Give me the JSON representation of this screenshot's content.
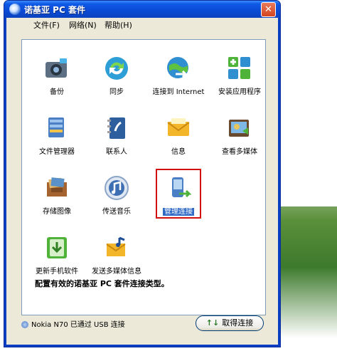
{
  "window": {
    "title": "诺基亚 PC 套件",
    "close_glyph": "✕"
  },
  "menu": [
    {
      "label": "文件(F)"
    },
    {
      "label": "网络(N)"
    },
    {
      "label": "帮助(H)"
    }
  ],
  "items": [
    {
      "label": "备份",
      "icon": "backup-camera-icon"
    },
    {
      "label": "同步",
      "icon": "sync-icon"
    },
    {
      "label": "连接到 Internet",
      "icon": "internet-connect-icon"
    },
    {
      "label": "安装应用程序",
      "icon": "install-apps-icon"
    },
    {
      "label": "文件管理器",
      "icon": "file-manager-icon"
    },
    {
      "label": "联系人",
      "icon": "contacts-icon"
    },
    {
      "label": "信息",
      "icon": "message-envelope-icon"
    },
    {
      "label": "查看多媒体",
      "icon": "multimedia-viewer-icon"
    },
    {
      "label": "存储图像",
      "icon": "store-images-icon"
    },
    {
      "label": "传送音乐",
      "icon": "music-transfer-icon"
    },
    {
      "label": "管理连接",
      "icon": "manage-connection-icon"
    },
    {
      "label": "更新手机软件",
      "icon": "update-phone-software-icon"
    },
    {
      "label": "发送多媒体信息",
      "icon": "send-multimedia-icon"
    }
  ],
  "info_text": "配置有效的诺基亚 PC 套件连接类型。",
  "status": {
    "text": "Nokia N70 已通过 USB 连接"
  },
  "cancel_button": {
    "label": "取得连接",
    "arrows": "↑↓"
  }
}
